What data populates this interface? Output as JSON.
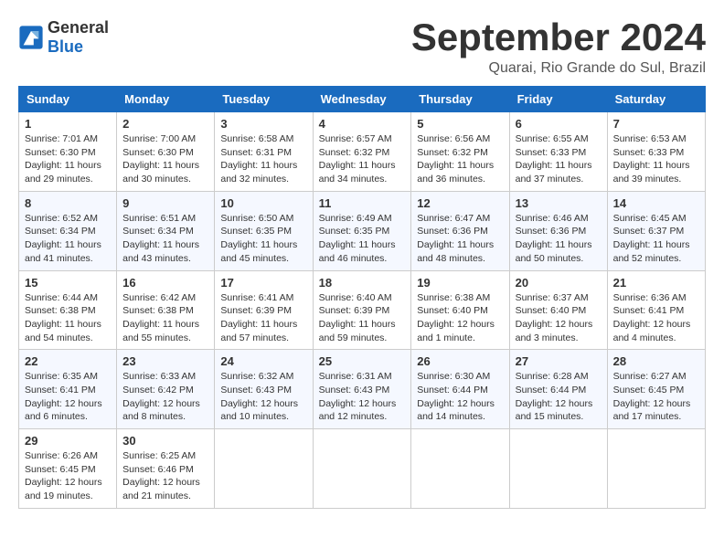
{
  "logo": {
    "general": "General",
    "blue": "Blue"
  },
  "title": "September 2024",
  "subtitle": "Quarai, Rio Grande do Sul, Brazil",
  "headers": [
    "Sunday",
    "Monday",
    "Tuesday",
    "Wednesday",
    "Thursday",
    "Friday",
    "Saturday"
  ],
  "weeks": [
    [
      {
        "day": "1",
        "info": "Sunrise: 7:01 AM\nSunset: 6:30 PM\nDaylight: 11 hours\nand 29 minutes."
      },
      {
        "day": "2",
        "info": "Sunrise: 7:00 AM\nSunset: 6:30 PM\nDaylight: 11 hours\nand 30 minutes."
      },
      {
        "day": "3",
        "info": "Sunrise: 6:58 AM\nSunset: 6:31 PM\nDaylight: 11 hours\nand 32 minutes."
      },
      {
        "day": "4",
        "info": "Sunrise: 6:57 AM\nSunset: 6:32 PM\nDaylight: 11 hours\nand 34 minutes."
      },
      {
        "day": "5",
        "info": "Sunrise: 6:56 AM\nSunset: 6:32 PM\nDaylight: 11 hours\nand 36 minutes."
      },
      {
        "day": "6",
        "info": "Sunrise: 6:55 AM\nSunset: 6:33 PM\nDaylight: 11 hours\nand 37 minutes."
      },
      {
        "day": "7",
        "info": "Sunrise: 6:53 AM\nSunset: 6:33 PM\nDaylight: 11 hours\nand 39 minutes."
      }
    ],
    [
      {
        "day": "8",
        "info": "Sunrise: 6:52 AM\nSunset: 6:34 PM\nDaylight: 11 hours\nand 41 minutes."
      },
      {
        "day": "9",
        "info": "Sunrise: 6:51 AM\nSunset: 6:34 PM\nDaylight: 11 hours\nand 43 minutes."
      },
      {
        "day": "10",
        "info": "Sunrise: 6:50 AM\nSunset: 6:35 PM\nDaylight: 11 hours\nand 45 minutes."
      },
      {
        "day": "11",
        "info": "Sunrise: 6:49 AM\nSunset: 6:35 PM\nDaylight: 11 hours\nand 46 minutes."
      },
      {
        "day": "12",
        "info": "Sunrise: 6:47 AM\nSunset: 6:36 PM\nDaylight: 11 hours\nand 48 minutes."
      },
      {
        "day": "13",
        "info": "Sunrise: 6:46 AM\nSunset: 6:36 PM\nDaylight: 11 hours\nand 50 minutes."
      },
      {
        "day": "14",
        "info": "Sunrise: 6:45 AM\nSunset: 6:37 PM\nDaylight: 11 hours\nand 52 minutes."
      }
    ],
    [
      {
        "day": "15",
        "info": "Sunrise: 6:44 AM\nSunset: 6:38 PM\nDaylight: 11 hours\nand 54 minutes."
      },
      {
        "day": "16",
        "info": "Sunrise: 6:42 AM\nSunset: 6:38 PM\nDaylight: 11 hours\nand 55 minutes."
      },
      {
        "day": "17",
        "info": "Sunrise: 6:41 AM\nSunset: 6:39 PM\nDaylight: 11 hours\nand 57 minutes."
      },
      {
        "day": "18",
        "info": "Sunrise: 6:40 AM\nSunset: 6:39 PM\nDaylight: 11 hours\nand 59 minutes."
      },
      {
        "day": "19",
        "info": "Sunrise: 6:38 AM\nSunset: 6:40 PM\nDaylight: 12 hours\nand 1 minute."
      },
      {
        "day": "20",
        "info": "Sunrise: 6:37 AM\nSunset: 6:40 PM\nDaylight: 12 hours\nand 3 minutes."
      },
      {
        "day": "21",
        "info": "Sunrise: 6:36 AM\nSunset: 6:41 PM\nDaylight: 12 hours\nand 4 minutes."
      }
    ],
    [
      {
        "day": "22",
        "info": "Sunrise: 6:35 AM\nSunset: 6:41 PM\nDaylight: 12 hours\nand 6 minutes."
      },
      {
        "day": "23",
        "info": "Sunrise: 6:33 AM\nSunset: 6:42 PM\nDaylight: 12 hours\nand 8 minutes."
      },
      {
        "day": "24",
        "info": "Sunrise: 6:32 AM\nSunset: 6:43 PM\nDaylight: 12 hours\nand 10 minutes."
      },
      {
        "day": "25",
        "info": "Sunrise: 6:31 AM\nSunset: 6:43 PM\nDaylight: 12 hours\nand 12 minutes."
      },
      {
        "day": "26",
        "info": "Sunrise: 6:30 AM\nSunset: 6:44 PM\nDaylight: 12 hours\nand 14 minutes."
      },
      {
        "day": "27",
        "info": "Sunrise: 6:28 AM\nSunset: 6:44 PM\nDaylight: 12 hours\nand 15 minutes."
      },
      {
        "day": "28",
        "info": "Sunrise: 6:27 AM\nSunset: 6:45 PM\nDaylight: 12 hours\nand 17 minutes."
      }
    ],
    [
      {
        "day": "29",
        "info": "Sunrise: 6:26 AM\nSunset: 6:45 PM\nDaylight: 12 hours\nand 19 minutes."
      },
      {
        "day": "30",
        "info": "Sunrise: 6:25 AM\nSunset: 6:46 PM\nDaylight: 12 hours\nand 21 minutes."
      },
      {
        "day": "",
        "info": ""
      },
      {
        "day": "",
        "info": ""
      },
      {
        "day": "",
        "info": ""
      },
      {
        "day": "",
        "info": ""
      },
      {
        "day": "",
        "info": ""
      }
    ]
  ]
}
